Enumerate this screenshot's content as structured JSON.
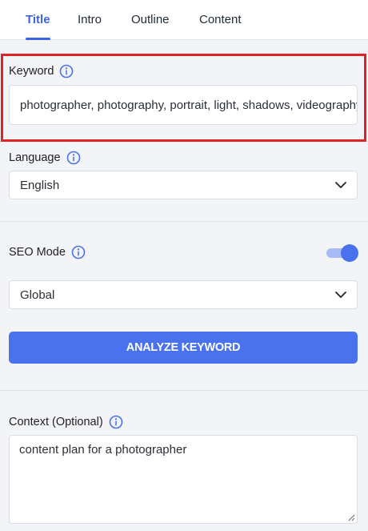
{
  "tabs": [
    {
      "label": "Title",
      "active": true
    },
    {
      "label": "Intro",
      "active": false
    },
    {
      "label": "Outline",
      "active": false
    },
    {
      "label": "Content",
      "active": false
    }
  ],
  "keyword": {
    "label": "Keyword",
    "value": "photographer, photography, portrait, light, shadows, videography"
  },
  "language": {
    "label": "Language",
    "selected": "English"
  },
  "seo_mode": {
    "label": "SEO Mode",
    "enabled": true,
    "selected": "Global"
  },
  "analyze_button": {
    "label": "ANALYZE KEYWORD"
  },
  "context": {
    "label": "Context (Optional)",
    "value": "content plan for a photographer"
  },
  "colors": {
    "accent": "#4a72ee",
    "highlight_border": "#e02424"
  },
  "icons": {
    "info": "info-icon",
    "dropdown": "chevron-down-icon"
  }
}
